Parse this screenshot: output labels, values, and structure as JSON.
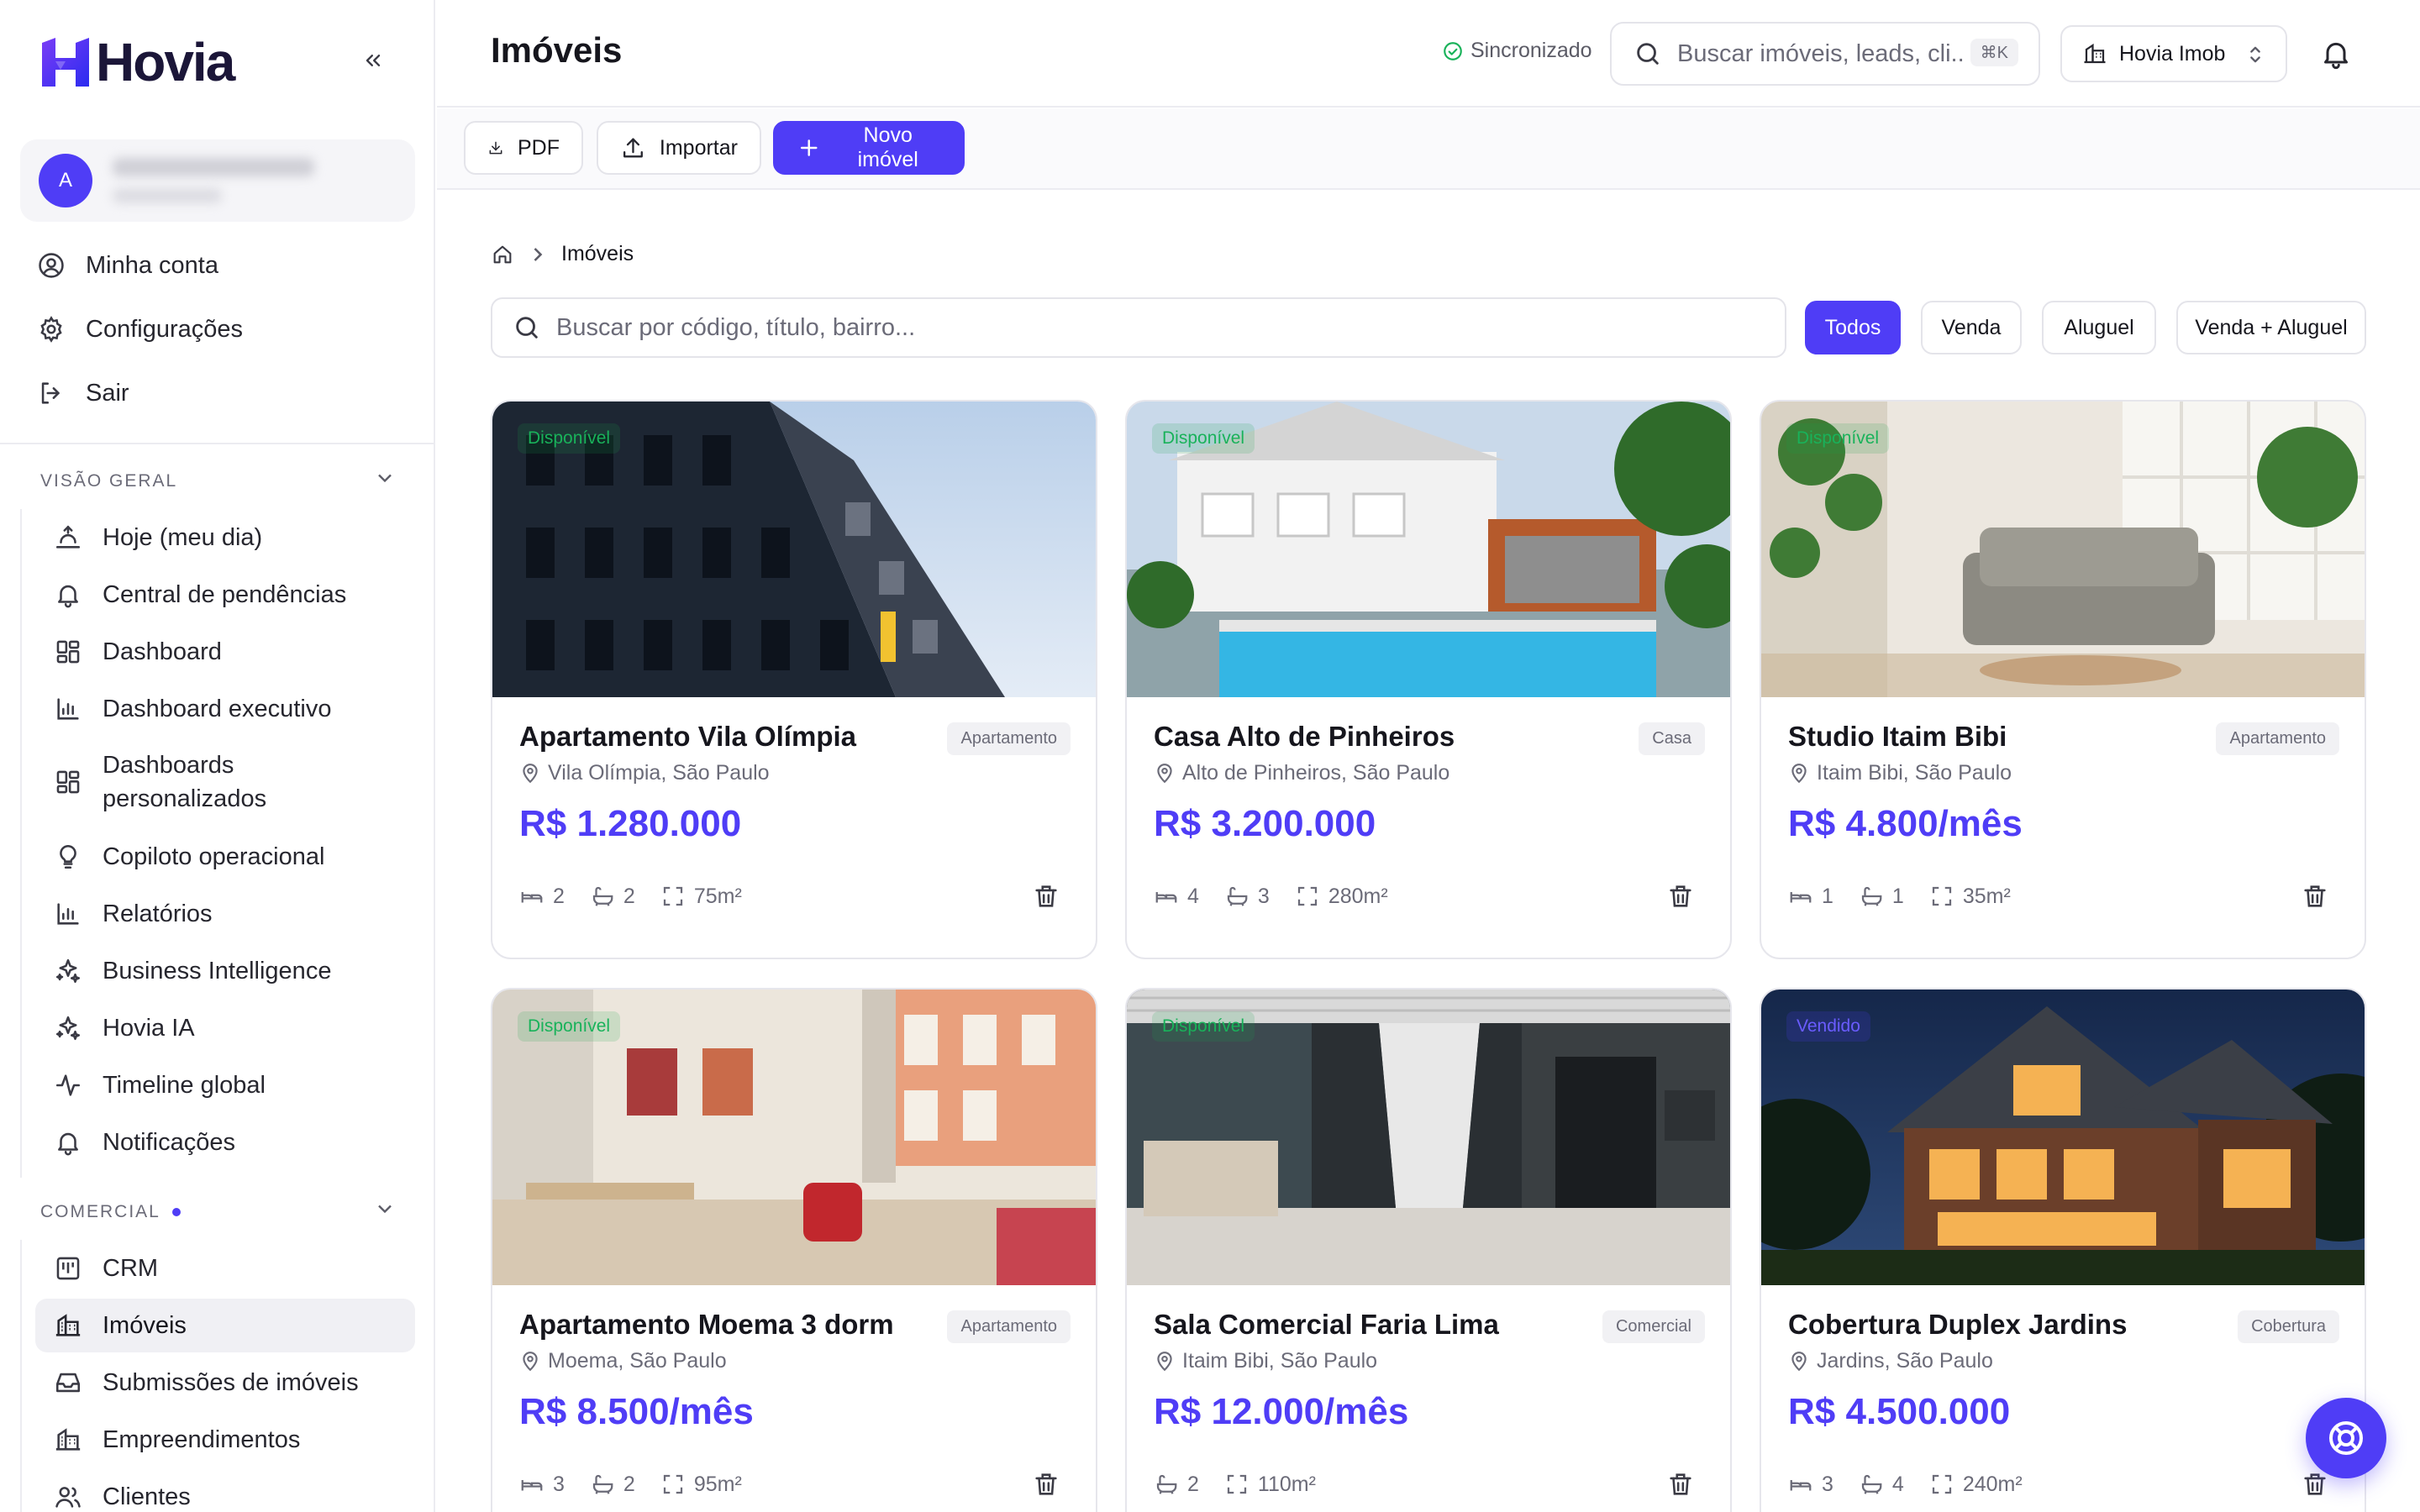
{
  "brand": {
    "name": "Hovia",
    "primary": "#4f3df6",
    "logo_colors": [
      "#6a3df6",
      "#2b2bf0"
    ]
  },
  "user": {
    "avatar_letter": "A"
  },
  "account_menu": [
    {
      "icon": "user-circle-icon",
      "label": "Minha conta"
    },
    {
      "icon": "gear-icon",
      "label": "Configurações"
    },
    {
      "icon": "logout-icon",
      "label": "Sair"
    }
  ],
  "sidebar": {
    "sections": [
      {
        "title": "VISÃO GERAL",
        "items": [
          {
            "icon": "sunrise-icon",
            "label": "Hoje (meu dia)"
          },
          {
            "icon": "bell-icon",
            "label": "Central de pendências"
          },
          {
            "icon": "dashboard-icon",
            "label": "Dashboard"
          },
          {
            "icon": "bar-chart-icon",
            "label": "Dashboard executivo"
          },
          {
            "icon": "dashboard-icon",
            "label": "Dashboards",
            "label2": "personalizados"
          },
          {
            "icon": "lightbulb-icon",
            "label": "Copiloto operacional"
          },
          {
            "icon": "bar-chart-icon",
            "label": "Relatórios"
          },
          {
            "icon": "sparkles-icon",
            "label": "Business Intelligence"
          },
          {
            "icon": "sparkles-icon",
            "label": "Hovia IA"
          },
          {
            "icon": "activity-icon",
            "label": "Timeline global"
          },
          {
            "icon": "bell-icon",
            "label": "Notificações"
          }
        ]
      },
      {
        "title": "COMERCIAL",
        "items": [
          {
            "icon": "kanban-icon",
            "label": "CRM"
          },
          {
            "icon": "building-icon",
            "label": "Imóveis",
            "active": true
          },
          {
            "icon": "inbox-icon",
            "label": "Submissões de imóveis"
          },
          {
            "icon": "building-icon",
            "label": "Empreendimentos"
          },
          {
            "icon": "users-icon",
            "label": "Clientes"
          }
        ]
      }
    ]
  },
  "topbar": {
    "title": "Imóveis",
    "sync_status": "Sincronizado",
    "search_placeholder": "Buscar imóveis, leads, cli...",
    "shortcut": "⌘K",
    "org_name": "Hovia Imob"
  },
  "actions": {
    "pdf": "PDF",
    "import": "Importar",
    "new": "Novo imóvel"
  },
  "breadcrumb": {
    "current": "Imóveis"
  },
  "list_search_placeholder": "Buscar por código, título, bairro...",
  "filters": [
    {
      "label": "Todos",
      "active": true
    },
    {
      "label": "Venda"
    },
    {
      "label": "Aluguel"
    },
    {
      "label": "Venda + Aluguel"
    }
  ],
  "properties": [
    {
      "status": "Disponível",
      "title": "Apartamento Vila Olímpia",
      "type": "Apartamento",
      "location": "Vila Olímpia, São Paulo",
      "price": "R$ 1.280.000",
      "beds": "2",
      "baths": "2",
      "area": "75m²"
    },
    {
      "status": "Disponível",
      "title": "Casa Alto de Pinheiros",
      "type": "Casa",
      "location": "Alto de Pinheiros, São Paulo",
      "price": "R$ 3.200.000",
      "beds": "4",
      "baths": "3",
      "area": "280m²"
    },
    {
      "status": "Disponível",
      "title": "Studio Itaim Bibi",
      "type": "Apartamento",
      "location": "Itaim Bibi, São Paulo",
      "price": "R$ 4.800/mês",
      "beds": "1",
      "baths": "1",
      "area": "35m²"
    },
    {
      "status": "Disponível",
      "title": "Apartamento Moema 3 dorm",
      "type": "Apartamento",
      "location": "Moema, São Paulo",
      "price": "R$ 8.500/mês",
      "beds": "3",
      "baths": "2",
      "area": "95m²"
    },
    {
      "status": "Disponível",
      "title": "Sala Comercial Faria Lima",
      "type": "Comercial",
      "location": "Itaim Bibi, São Paulo",
      "price": "R$ 12.000/mês",
      "baths": "2",
      "area": "110m²"
    },
    {
      "status": "Vendido",
      "title": "Cobertura Duplex Jardins",
      "type": "Cobertura",
      "location": "Jardins, São Paulo",
      "price": "R$ 4.500.000",
      "beds": "3",
      "baths": "4",
      "area": "240m²"
    }
  ]
}
